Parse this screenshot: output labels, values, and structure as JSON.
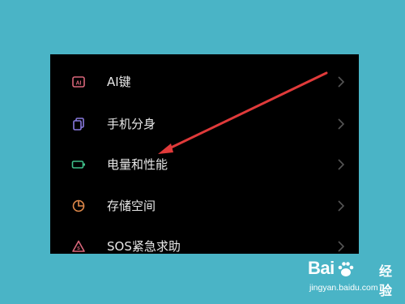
{
  "settings": {
    "items": [
      {
        "label": "AI键",
        "icon": "ai-key-icon",
        "icon_color": "#d9667a"
      },
      {
        "label": "手机分身",
        "icon": "phone-clone-icon",
        "icon_color": "#8a7be0"
      },
      {
        "label": "电量和性能",
        "icon": "battery-icon",
        "icon_color": "#3fc08a"
      },
      {
        "label": "存储空间",
        "icon": "storage-pie-icon",
        "icon_color": "#e0894a"
      },
      {
        "label": "SOS紧急求助",
        "icon": "sos-warning-icon",
        "icon_color": "#d9667a"
      }
    ]
  },
  "annotation": {
    "type": "arrow",
    "color": "#e03a3a",
    "points_to": "电量和性能"
  },
  "watermark": {
    "logo_text": "Bai",
    "logo_suffix": "经验",
    "url": "jingyan.baidu.com"
  }
}
